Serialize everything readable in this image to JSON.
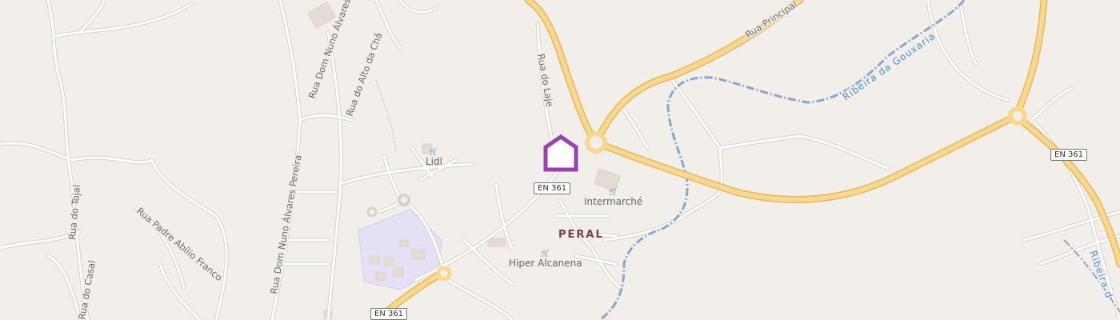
{
  "streets": [
    {
      "id": "rua-principal",
      "label": "Rua Principal"
    },
    {
      "id": "rua-dom-nuno-1",
      "label": "Rua Dom Nuno Álvares Pereira"
    },
    {
      "id": "rua-alto-cha",
      "label": "Rua do Alto da Chã"
    },
    {
      "id": "rua-laje",
      "label": "Rua do Laje"
    },
    {
      "id": "rua-tojal",
      "label": "Rua do Tojal"
    },
    {
      "id": "rua-padre",
      "label": "Rua Padre Abílio Franco"
    },
    {
      "id": "rua-dom-nuno-2",
      "label": "Rua Dom Nuno Álvares Pereira"
    },
    {
      "id": "rua-casal",
      "label": "Rua do Casal"
    }
  ],
  "waterways": [
    {
      "id": "ribeira-gouxaria",
      "label": "Ribeira da Gouxaria"
    },
    {
      "id": "ribeira-2",
      "label": "Ribeira d"
    }
  ],
  "road_shields": [
    "EN 361",
    "EN 361",
    "EN 361"
  ],
  "pois": [
    {
      "id": "lidl",
      "label": "Lidl",
      "icon": "shopping-cart-icon"
    },
    {
      "id": "intermarche",
      "label": "Intermarché",
      "icon": "shopping-cart-icon"
    },
    {
      "id": "hiper",
      "label": "Hiper Alcanena",
      "icon": "shopping-cart-icon"
    }
  ],
  "locality": "PERAL",
  "marker": {
    "icon": "home-marker-icon",
    "color": "#9b3fb5"
  },
  "colors": {
    "background": "#f2efea",
    "highway": "#f8d88f",
    "highway_casing": "#e2b85e",
    "street": "#ffffff",
    "street_casing": "#d9d5cf",
    "water": "#6f9ad2",
    "landuse": "#e6e0f5",
    "building": "#e4dcd2"
  }
}
